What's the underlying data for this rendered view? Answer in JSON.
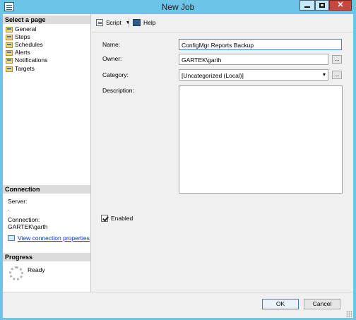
{
  "window": {
    "title": "New Job",
    "close_glyph": "✕"
  },
  "select_page": {
    "header": "Select a page",
    "items": [
      {
        "label": "General",
        "icon": "page-icon"
      },
      {
        "label": "Steps",
        "icon": "page-icon"
      },
      {
        "label": "Schedules",
        "icon": "page-icon"
      },
      {
        "label": "Alerts",
        "icon": "page-icon"
      },
      {
        "label": "Notifications",
        "icon": "page-icon"
      },
      {
        "label": "Targets",
        "icon": "page-icon"
      }
    ]
  },
  "connection": {
    "header": "Connection",
    "server_label": "Server:",
    "server_value": ".",
    "connection_label": "Connection:",
    "connection_value": "GARTEK\\garth",
    "view_link": "View connection properties"
  },
  "progress": {
    "header": "Progress",
    "status": "Ready"
  },
  "toolbar": {
    "script_label": "Script",
    "caret": "▼",
    "help_label": "Help"
  },
  "form": {
    "name_label": "Name:",
    "name_value": "ConfigMgr Reports Backup",
    "owner_label": "Owner:",
    "owner_value": "GARTEK\\garth",
    "owner_button": "...",
    "category_label": "Category:",
    "category_value": "[Uncategorized (Local)]",
    "category_caret": "▾",
    "category_button": "...",
    "description_label": "Description:",
    "description_value": "",
    "enabled_label": "Enabled",
    "enabled_checked": true
  },
  "buttons": {
    "ok": "OK",
    "cancel": "Cancel"
  },
  "colors": {
    "titlebar": "#6cc4e7",
    "close_button": "#c7463e",
    "link": "#0033cc"
  }
}
